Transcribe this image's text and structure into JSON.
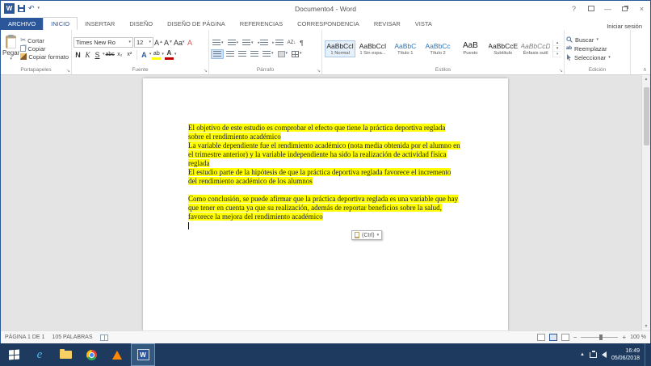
{
  "colors": {
    "accent": "#2B579A",
    "highlight": "#FFFF00",
    "taskbar_bg": "#1E3A5E"
  },
  "titlebar": {
    "title": "Documento4 - Word",
    "sign_in": "Iniciar sesión"
  },
  "tabs": [
    "ARCHIVO",
    "INICIO",
    "INSERTAR",
    "DISEÑO",
    "DISEÑO DE PÁGINA",
    "REFERENCIAS",
    "CORRESPONDENCIA",
    "REVISAR",
    "VISTA"
  ],
  "ribbon": {
    "clipboard": {
      "label": "Portapapeles",
      "paste": "Pegar",
      "cut": "Cortar",
      "copy": "Copiar",
      "format_painter": "Copiar formato"
    },
    "font": {
      "label": "Fuente",
      "name": "Times New Ro",
      "size": "12",
      "grow": "A",
      "shrink": "A",
      "case": "Aa",
      "clear": "A",
      "bold": "N",
      "italic": "K",
      "underline": "S",
      "strike": "abc",
      "subscript": "x₂",
      "superscript": "x²",
      "effects": "A",
      "highlight": "ab",
      "color": "A"
    },
    "paragraph": {
      "label": "Párrafo",
      "sort": "AZ↓",
      "pilcrow": "¶"
    },
    "styles": {
      "label": "Estilos",
      "items": [
        {
          "preview": "AaBbCcI",
          "name": "1 Normal"
        },
        {
          "preview": "AaBbCcI",
          "name": "1 Sin espa..."
        },
        {
          "preview": "AaBbC",
          "name": "Título 1"
        },
        {
          "preview": "AaBbCc",
          "name": "Título 2"
        },
        {
          "preview": "AaB",
          "name": "Puesto"
        },
        {
          "preview": "AaBbCcE",
          "name": "Subtítulo"
        },
        {
          "preview": "AaBbCcD",
          "name": "Énfasis sutil"
        }
      ]
    },
    "editing": {
      "label": "Edición",
      "find": "Buscar",
      "replace": "Reemplazar",
      "select": "Seleccionar"
    }
  },
  "document": {
    "paragraphs": [
      "El objetivo de este estudio es comprobar el efecto que tiene la práctica deportiva reglada sobre el rendimiento académico",
      "La variable dependiente fue el rendimiento académico (nota media obtenida por el alumno en el trimestre anterior) y la variable independiente ha sido la realización de actividad física reglada",
      "El estudio parte de la hipótesis de que la práctica deportiva reglada favorece el incremento del rendimiento académico de los alumnos",
      "",
      "Como conclusión, se puede afirmar que la práctica deportiva reglada es una variable que hay que tener en cuenta ya que su realización, además de reportar beneficios sobre la salud, favorece la mejora del rendimiento académico"
    ],
    "paste_options": "(Ctrl)"
  },
  "status_bar": {
    "page_info": "PÁGINA 1 DE 1",
    "word_count": "105 PALABRAS",
    "zoom": "100 %"
  },
  "taskbar": {
    "time": "16:49",
    "date": "05/06/2018"
  },
  "icons": {
    "caret": "▾",
    "cut": "✂",
    "undo": "↶",
    "launcher": "↘",
    "collapse_ribbon": "∧",
    "help": "?",
    "minimize": "—",
    "close": "×",
    "word_logo": "W",
    "ie_logo": "e",
    "replace_glyph": "ab",
    "scroll_up": "▲",
    "scroll_down": "▼",
    "tray_expand": "▲",
    "zoom_out": "−",
    "zoom_in": "+",
    "indent_left": "◂",
    "indent_right": "▸"
  }
}
